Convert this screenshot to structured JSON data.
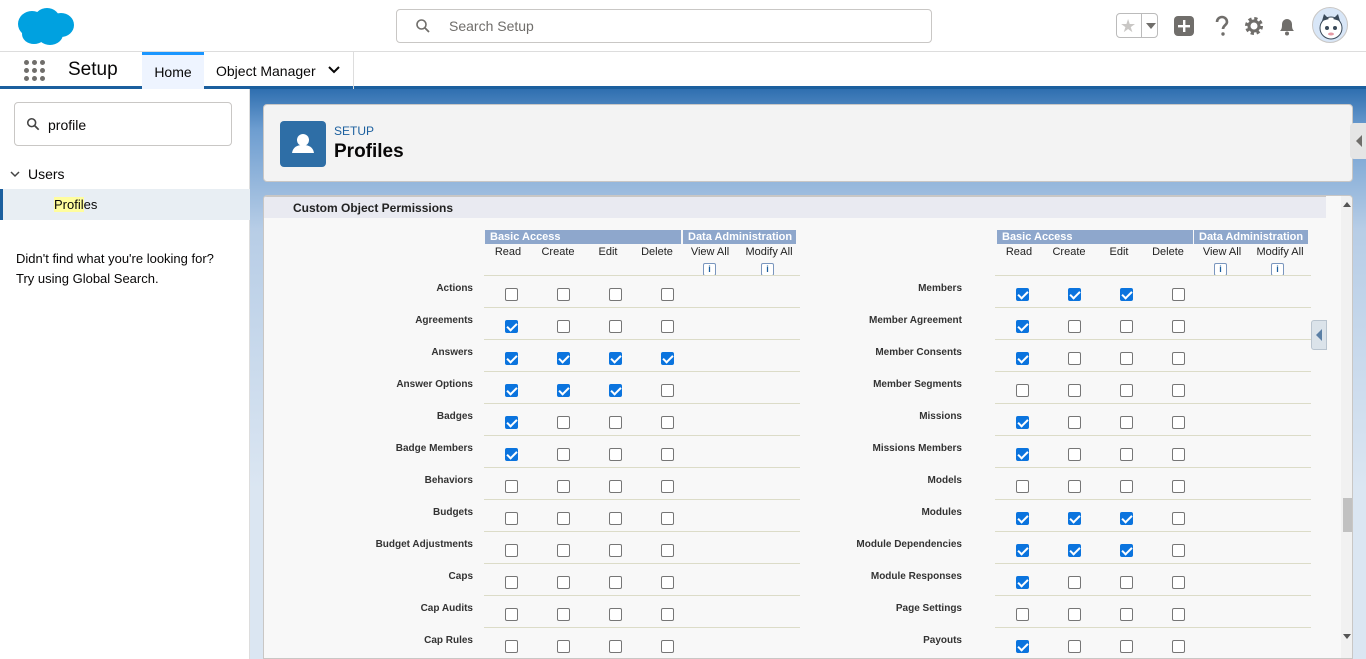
{
  "topbar": {
    "search_placeholder": "Search Setup",
    "icons": [
      "favorites-star-icon",
      "add-icon",
      "help-icon",
      "gear-icon",
      "bell-icon",
      "avatar"
    ]
  },
  "nav": {
    "app_name": "Setup",
    "tabs": [
      {
        "label": "Home"
      },
      {
        "label": "Object Manager"
      }
    ]
  },
  "sidebar": {
    "search_value": "profile",
    "tree_parent": "Users",
    "tree_child": {
      "highlight": "Profil",
      "rest": "es"
    },
    "not_found_1": "Didn't find what you're looking for?",
    "not_found_2": "Try using Global Search."
  },
  "header": {
    "breadcrumb": "SETUP",
    "title": "Profiles"
  },
  "section": {
    "title": "Custom Object Permissions",
    "group_basic": "Basic Access",
    "group_data": "Data Administration",
    "columns": [
      "Read",
      "Create",
      "Edit",
      "Delete",
      "View All",
      "Modify All"
    ],
    "info_glyph": "i"
  },
  "left_rows": [
    {
      "label": "Actions",
      "perms": [
        0,
        0,
        0,
        0
      ]
    },
    {
      "label": "Agreements",
      "perms": [
        1,
        0,
        0,
        0
      ]
    },
    {
      "label": "Answers",
      "perms": [
        1,
        1,
        1,
        1
      ]
    },
    {
      "label": "Answer Options",
      "perms": [
        1,
        1,
        1,
        0
      ]
    },
    {
      "label": "Badges",
      "perms": [
        1,
        0,
        0,
        0
      ]
    },
    {
      "label": "Badge Members",
      "perms": [
        1,
        0,
        0,
        0
      ]
    },
    {
      "label": "Behaviors",
      "perms": [
        0,
        0,
        0,
        0
      ]
    },
    {
      "label": "Budgets",
      "perms": [
        0,
        0,
        0,
        0
      ]
    },
    {
      "label": "Budget Adjustments",
      "perms": [
        0,
        0,
        0,
        0
      ]
    },
    {
      "label": "Caps",
      "perms": [
        0,
        0,
        0,
        0
      ]
    },
    {
      "label": "Cap Audits",
      "perms": [
        0,
        0,
        0,
        0
      ]
    },
    {
      "label": "Cap Rules",
      "perms": [
        0,
        0,
        0,
        0
      ]
    }
  ],
  "right_rows": [
    {
      "label": "Members",
      "perms": [
        1,
        1,
        1,
        0
      ]
    },
    {
      "label": "Member Agreement",
      "perms": [
        1,
        0,
        0,
        0
      ]
    },
    {
      "label": "Member Consents",
      "perms": [
        1,
        0,
        0,
        0
      ]
    },
    {
      "label": "Member Segments",
      "perms": [
        0,
        0,
        0,
        0
      ]
    },
    {
      "label": "Missions",
      "perms": [
        1,
        0,
        0,
        0
      ]
    },
    {
      "label": "Missions Members",
      "perms": [
        1,
        0,
        0,
        0
      ]
    },
    {
      "label": "Models",
      "perms": [
        0,
        0,
        0,
        0
      ]
    },
    {
      "label": "Modules",
      "perms": [
        1,
        1,
        1,
        0
      ]
    },
    {
      "label": "Module Dependencies",
      "perms": [
        1,
        1,
        1,
        0
      ]
    },
    {
      "label": "Module Responses",
      "perms": [
        1,
        0,
        0,
        0
      ]
    },
    {
      "label": "Page Settings",
      "perms": [
        0,
        0,
        0,
        0
      ]
    },
    {
      "label": "Payouts",
      "perms": [
        1,
        0,
        0,
        0
      ]
    }
  ],
  "colors": {
    "accent": "#1b96ff",
    "checkbox_checked": "#0b74de",
    "group_header": "#8ea7cc",
    "brand_blue": "#1b5f9e"
  }
}
